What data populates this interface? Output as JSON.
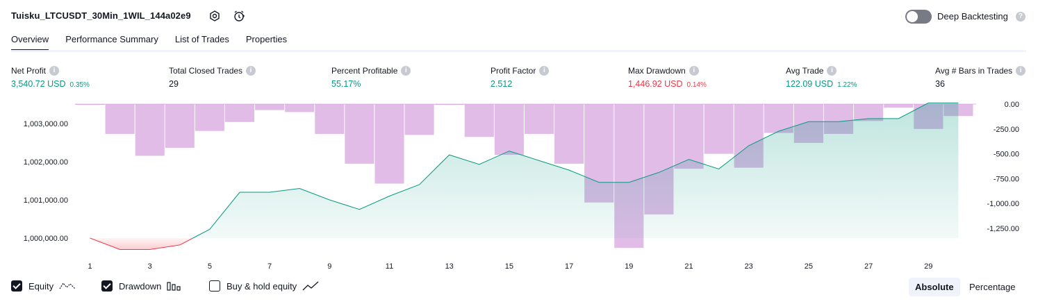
{
  "header": {
    "title": "Tuisku_LTCUSDT_30Min_1WIL_144a02e9",
    "deep_backtesting_label": "Deep Backtesting",
    "deep_backtesting_enabled": false
  },
  "tabs": [
    {
      "label": "Overview",
      "active": true
    },
    {
      "label": "Performance Summary",
      "active": false
    },
    {
      "label": "List of Trades",
      "active": false
    },
    {
      "label": "Properties",
      "active": false
    }
  ],
  "metrics": [
    {
      "label": "Net Profit",
      "value": "3,540.72 USD",
      "pct": "0.35%",
      "color": "#089981"
    },
    {
      "label": "Total Closed Trades",
      "value": "29",
      "pct": "",
      "color": "#131722"
    },
    {
      "label": "Percent Profitable",
      "value": "55.17%",
      "pct": "",
      "color": "#089981"
    },
    {
      "label": "Profit Factor",
      "value": "2.512",
      "pct": "",
      "color": "#089981"
    },
    {
      "label": "Max Drawdown",
      "value": "1,446.92 USD",
      "pct": "0.14%",
      "color": "#f23645"
    },
    {
      "label": "Avg Trade",
      "value": "122.09 USD",
      "pct": "1.22%",
      "color": "#089981"
    },
    {
      "label": "Avg # Bars in Trades",
      "value": "36",
      "pct": "",
      "color": "#131722"
    }
  ],
  "chart_data": {
    "type": "line",
    "x": [
      1,
      2,
      3,
      4,
      5,
      6,
      7,
      8,
      9,
      10,
      11,
      12,
      13,
      14,
      15,
      16,
      17,
      18,
      19,
      20,
      21,
      22,
      23,
      24,
      25,
      26,
      27,
      28,
      29,
      30
    ],
    "x_tick_labels": [
      "1",
      "3",
      "5",
      "7",
      "9",
      "11",
      "13",
      "15",
      "17",
      "19",
      "21",
      "23",
      "25",
      "27",
      "29"
    ],
    "equity": {
      "values": [
        1000000,
        999700,
        999700,
        999820,
        1000230,
        1001200,
        1001200,
        1001300,
        1001000,
        1000750,
        1001100,
        1001400,
        1002180,
        1001930,
        1002280,
        1002030,
        1001780,
        1001460,
        1001460,
        1001720,
        1002060,
        1001810,
        1002420,
        1002800,
        1003050,
        1003050,
        1003130,
        1003130,
        1003540,
        1003540
      ],
      "left_axis_ticks": [
        "1,000,000.00",
        "1,001,000.00",
        "1,002,000.00",
        "1,003,000.00"
      ],
      "color": "#089981",
      "below_start_color": "#f23645"
    },
    "drawdown": {
      "values": [
        -5,
        -300,
        -520,
        -440,
        -270,
        -180,
        -60,
        -80,
        -300,
        -600,
        -800,
        -310,
        0,
        -330,
        -510,
        -300,
        -600,
        -990,
        -1446.92,
        -1110,
        -650,
        -500,
        -640,
        -290,
        -390,
        -300,
        -170,
        -35,
        -250,
        -120
      ],
      "right_axis_ticks": [
        "0.00",
        "-250.00",
        "-500.00",
        "-750.00",
        "-1,000.00",
        "-1,250.00"
      ],
      "color": "#ce93d8"
    }
  },
  "footer": {
    "toggles": [
      {
        "label": "Equity",
        "checked": true,
        "icon": "equity-line-icon"
      },
      {
        "label": "Drawdown",
        "checked": true,
        "icon": "drawdown-bars-icon"
      },
      {
        "label": "Buy & hold equity",
        "checked": false,
        "icon": "buy-hold-line-icon"
      }
    ],
    "modes": [
      {
        "label": "Absolute",
        "active": true
      },
      {
        "label": "Percentage",
        "active": false
      }
    ]
  }
}
